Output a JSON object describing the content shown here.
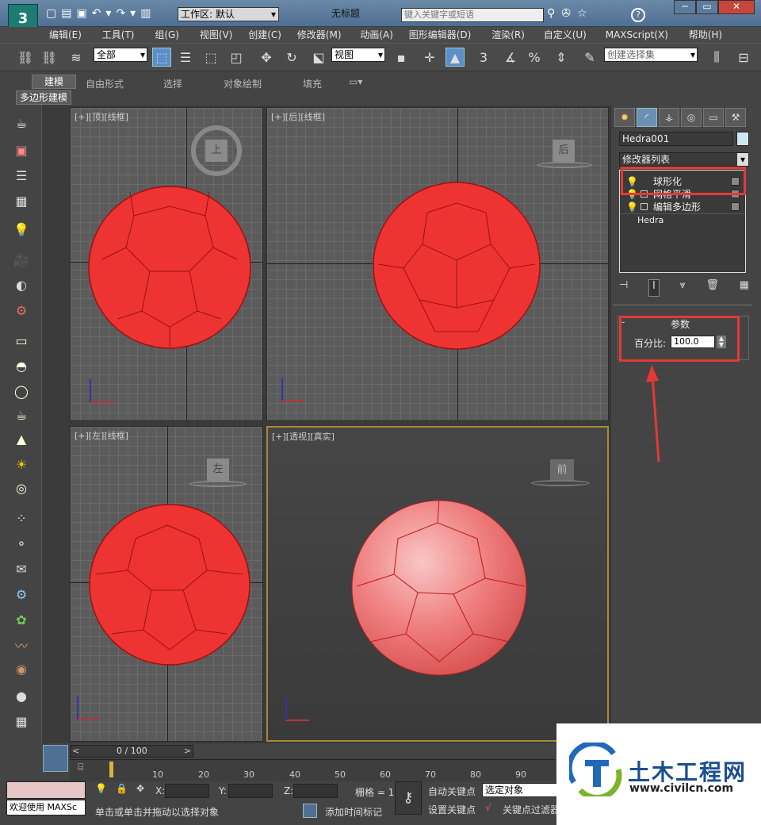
{
  "titlebar": {
    "workspace_label": "工作区: 默认",
    "doc_title": "无标题",
    "search_placeholder": "键入关键字或短语",
    "help_icon": "?"
  },
  "menu": [
    "编辑(E)",
    "工具(T)",
    "组(G)",
    "视图(V)",
    "创建(C)",
    "修改器(M)",
    "动画(A)",
    "图形编辑器(D)",
    "渲染(R)",
    "自定义(U)",
    "MAXScript(X)",
    "帮助(H)"
  ],
  "toolbar": {
    "filter_value": "全部",
    "coord_value": "视图",
    "selection_set_placeholder": "创建选择集",
    "snap_label": "3",
    "percent_label": "%"
  },
  "ribbon": {
    "tabs": [
      "建模",
      "自由形式",
      "选择",
      "对象绘制",
      "填充"
    ],
    "active_tab": "建模",
    "sub_label": "多边形建模"
  },
  "viewports": {
    "top": {
      "label": "[+][顶][线框]",
      "cube_label": "上"
    },
    "back": {
      "label": "[+][后][线框]",
      "cube_label": "后"
    },
    "left": {
      "label": "[+][左][线框]",
      "cube_label": "左"
    },
    "persp": {
      "label": "[+][透视][真实]",
      "cube_label": "前"
    }
  },
  "command_panel": {
    "object_name": "Hedra001",
    "object_color": "#cfe8f0",
    "modifier_list_label": "修改器列表",
    "stack": [
      {
        "name": "球形化",
        "selected": true
      },
      {
        "name": "网格平滑",
        "selected": false
      },
      {
        "name": "编辑多边形",
        "selected": false
      },
      {
        "name": "Hedra",
        "selected": false
      }
    ],
    "params_title": "参数",
    "percent_label": "百分比:",
    "percent_value": "100.0"
  },
  "timeline": {
    "frame_display": "0 / 100",
    "ticks": [
      "10",
      "20",
      "30",
      "40",
      "50",
      "60",
      "70",
      "80",
      "90"
    ]
  },
  "status": {
    "welcome": "欢迎使用 MAXSc",
    "prompt": "单击或单击并拖动以选择对象",
    "x_label": "X:",
    "y_label": "Y:",
    "z_label": "Z:",
    "grid_label": "栅格 = 1",
    "auto_key": "自动关键点",
    "set_key": "设置关键点",
    "selected_obj": "选定对象",
    "add_time_tag": "添加时间标记",
    "key_filter": "关键点过滤器"
  },
  "watermark": {
    "name": "土木工程网",
    "url": "www.civilcn.com"
  },
  "colors": {
    "object_red": "#ee3333",
    "highlight_red": "#e53935",
    "persp_sphere": "#ef6b6b"
  }
}
